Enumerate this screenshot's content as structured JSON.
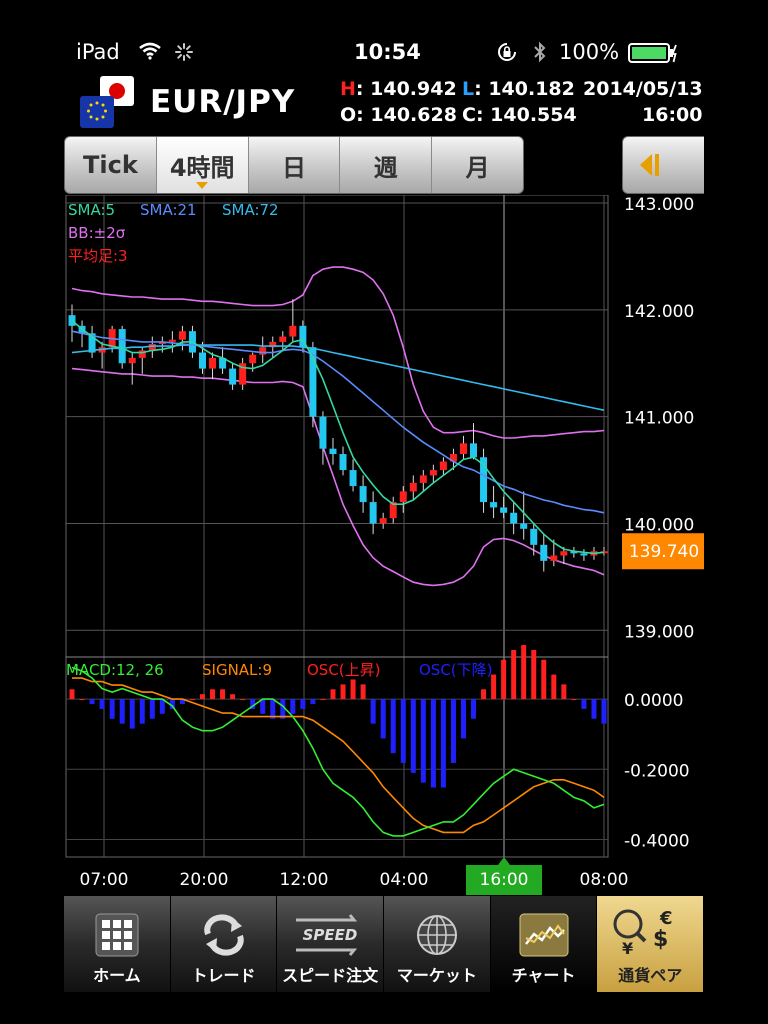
{
  "status": {
    "carrier": "iPad",
    "time": "10:54",
    "battery": "100%"
  },
  "header": {
    "pair": "EUR/JPY",
    "high_label": "H",
    "high": "140.942",
    "low_label": "L",
    "low": "140.182",
    "open_label": "O",
    "open": "140.628",
    "close_label": "C",
    "close": "140.554",
    "date": "2014/05/13",
    "time": "16:00"
  },
  "tabs": [
    "Tick",
    "4時間",
    "日",
    "週",
    "月"
  ],
  "selected_tab": 1,
  "chart_data": {
    "type": "line",
    "price_legend": [
      {
        "text": "SMA:5",
        "color": "#33d9a0"
      },
      {
        "text": "SMA:21",
        "color": "#5a8cff"
      },
      {
        "text": "SMA:72",
        "color": "#33bbee"
      }
    ],
    "bb_legend": {
      "text": "BB:±2σ",
      "color": "#e070f0"
    },
    "ha_legend": {
      "text": "平均足:3",
      "color": "#ff2020"
    },
    "price_ticks": [
      "143.000",
      "142.000",
      "141.000",
      "140.000",
      "139.000"
    ],
    "price_tick_values": [
      143,
      142,
      141,
      140,
      139
    ],
    "price_ylim": [
      138.75,
      143.0
    ],
    "current_price": "139.740",
    "current_price_value": 139.74,
    "macd_legend": [
      {
        "text": "MACD:12, 26",
        "color": "#33ee33"
      },
      {
        "text": "SIGNAL:9",
        "color": "#ff8800"
      },
      {
        "text": "OSC(上昇)",
        "color": "#ff2020"
      },
      {
        "text": "OSC(下降)",
        "color": "#2020ff"
      }
    ],
    "macd_ticks": [
      "0.0000",
      "-0.2000",
      "-0.4000"
    ],
    "macd_tick_values": [
      0,
      -0.2,
      -0.4
    ],
    "macd_ylim": [
      -0.45,
      0.12
    ],
    "time_labels": [
      "07:00",
      "20:00",
      "12:00",
      "04:00",
      "16:00",
      "08:00"
    ],
    "selected_time_label": 4,
    "candle_count": 54,
    "candles": [
      [
        141.95,
        142.05,
        141.7,
        141.85
      ],
      [
        141.85,
        141.9,
        141.65,
        141.78
      ],
      [
        141.78,
        141.85,
        141.55,
        141.6
      ],
      [
        141.6,
        141.7,
        141.45,
        141.65
      ],
      [
        141.65,
        141.85,
        141.6,
        141.82
      ],
      [
        141.82,
        141.85,
        141.45,
        141.5
      ],
      [
        141.5,
        141.6,
        141.3,
        141.55
      ],
      [
        141.55,
        141.65,
        141.4,
        141.62
      ],
      [
        141.62,
        141.75,
        141.55,
        141.68
      ],
      [
        141.68,
        141.75,
        141.6,
        141.7
      ],
      [
        141.7,
        141.8,
        141.6,
        141.72
      ],
      [
        141.72,
        141.85,
        141.62,
        141.8
      ],
      [
        141.8,
        141.85,
        141.55,
        141.6
      ],
      [
        141.6,
        141.7,
        141.4,
        141.45
      ],
      [
        141.45,
        141.6,
        141.35,
        141.55
      ],
      [
        141.55,
        141.65,
        141.4,
        141.45
      ],
      [
        141.45,
        141.5,
        141.25,
        141.3
      ],
      [
        141.3,
        141.55,
        141.25,
        141.5
      ],
      [
        141.5,
        141.6,
        141.42,
        141.58
      ],
      [
        141.58,
        141.75,
        141.5,
        141.65
      ],
      [
        141.65,
        141.75,
        141.55,
        141.7
      ],
      [
        141.7,
        141.8,
        141.62,
        141.75
      ],
      [
        141.75,
        142.1,
        141.7,
        141.85
      ],
      [
        141.85,
        141.9,
        141.6,
        141.65
      ],
      [
        141.65,
        141.7,
        140.9,
        141.0
      ],
      [
        141.0,
        141.05,
        140.55,
        140.7
      ],
      [
        140.7,
        140.8,
        140.55,
        140.65
      ],
      [
        140.65,
        140.72,
        140.45,
        140.5
      ],
      [
        140.5,
        140.6,
        140.3,
        140.35
      ],
      [
        140.35,
        140.45,
        140.1,
        140.2
      ],
      [
        140.2,
        140.3,
        139.9,
        140.0
      ],
      [
        140.0,
        140.1,
        139.95,
        140.05
      ],
      [
        140.05,
        140.25,
        140.0,
        140.2
      ],
      [
        140.2,
        140.35,
        140.1,
        140.3
      ],
      [
        140.3,
        140.45,
        140.22,
        140.38
      ],
      [
        140.38,
        140.5,
        140.3,
        140.45
      ],
      [
        140.45,
        140.55,
        140.38,
        140.5
      ],
      [
        140.5,
        140.62,
        140.45,
        140.58
      ],
      [
        140.58,
        140.7,
        140.5,
        140.65
      ],
      [
        140.65,
        140.82,
        140.6,
        140.75
      ],
      [
        140.75,
        140.94,
        140.6,
        140.62
      ],
      [
        140.62,
        140.7,
        140.1,
        140.2
      ],
      [
        140.2,
        140.35,
        140.05,
        140.15
      ],
      [
        140.15,
        140.25,
        140.05,
        140.1
      ],
      [
        140.1,
        140.2,
        139.9,
        140.0
      ],
      [
        140.0,
        140.3,
        139.85,
        139.95
      ],
      [
        139.95,
        140.0,
        139.7,
        139.8
      ],
      [
        139.8,
        139.9,
        139.55,
        139.65
      ],
      [
        139.65,
        139.85,
        139.6,
        139.7
      ],
      [
        139.7,
        139.78,
        139.62,
        139.74
      ],
      [
        139.74,
        139.78,
        139.68,
        139.72
      ],
      [
        139.72,
        139.76,
        139.65,
        139.7
      ],
      [
        139.7,
        139.78,
        139.66,
        139.74
      ],
      [
        139.74,
        139.78,
        139.7,
        139.74
      ]
    ],
    "sma5": [
      141.9,
      141.82,
      141.75,
      141.68,
      141.66,
      141.64,
      141.6,
      141.6,
      141.62,
      141.63,
      141.65,
      141.7,
      141.7,
      141.64,
      141.58,
      141.55,
      141.5,
      141.46,
      141.45,
      141.48,
      141.55,
      141.62,
      141.7,
      141.72,
      141.55,
      141.35,
      141.1,
      140.85,
      140.62,
      140.48,
      140.36,
      140.25,
      140.18,
      140.18,
      140.22,
      140.3,
      140.38,
      140.45,
      140.52,
      140.6,
      140.62,
      140.55,
      140.42,
      140.3,
      140.2,
      140.1,
      140.0,
      139.9,
      139.82,
      139.76,
      139.74,
      139.73,
      139.72,
      139.73
    ],
    "sma21": [
      141.8,
      141.78,
      141.76,
      141.74,
      141.73,
      141.72,
      141.71,
      141.7,
      141.7,
      141.7,
      141.69,
      141.68,
      141.67,
      141.66,
      141.65,
      141.64,
      141.63,
      141.62,
      141.61,
      141.6,
      141.6,
      141.62,
      141.63,
      141.62,
      141.58,
      141.52,
      141.45,
      141.38,
      141.3,
      141.22,
      141.14,
      141.06,
      140.98,
      140.9,
      140.83,
      140.76,
      140.7,
      140.64,
      140.58,
      140.53,
      140.5,
      140.45,
      140.4,
      140.35,
      140.32,
      140.28,
      140.25,
      140.22,
      140.2,
      140.17,
      140.15,
      140.13,
      140.12,
      140.1
    ],
    "sma72": [
      141.6,
      141.61,
      141.62,
      141.63,
      141.64,
      141.64,
      141.65,
      141.65,
      141.66,
      141.66,
      141.66,
      141.67,
      141.67,
      141.67,
      141.67,
      141.67,
      141.67,
      141.67,
      141.67,
      141.66,
      141.66,
      141.66,
      141.66,
      141.65,
      141.64,
      141.62,
      141.6,
      141.58,
      141.56,
      141.54,
      141.52,
      141.5,
      141.48,
      141.46,
      141.44,
      141.42,
      141.4,
      141.38,
      141.36,
      141.34,
      141.32,
      141.3,
      141.28,
      141.26,
      141.24,
      141.22,
      141.2,
      141.18,
      141.16,
      141.14,
      141.12,
      141.1,
      141.08,
      141.06
    ],
    "bb_upper": [
      142.2,
      142.18,
      142.17,
      142.15,
      142.14,
      142.13,
      142.12,
      142.12,
      142.11,
      142.1,
      142.1,
      142.1,
      142.09,
      142.08,
      142.08,
      142.07,
      142.06,
      142.05,
      142.04,
      142.04,
      142.04,
      142.05,
      142.08,
      142.14,
      142.32,
      142.38,
      142.4,
      142.4,
      142.38,
      142.35,
      142.28,
      142.15,
      141.95,
      141.65,
      141.3,
      141.05,
      140.9,
      140.85,
      140.85,
      140.86,
      140.87,
      140.85,
      140.82,
      140.8,
      140.8,
      140.81,
      140.82,
      140.82,
      140.83,
      140.84,
      140.85,
      140.86,
      140.86,
      140.87
    ],
    "bb_lower": [
      141.45,
      141.44,
      141.43,
      141.42,
      141.41,
      141.4,
      141.4,
      141.39,
      141.38,
      141.38,
      141.38,
      141.37,
      141.37,
      141.36,
      141.36,
      141.35,
      141.34,
      141.33,
      141.32,
      141.32,
      141.32,
      141.33,
      141.32,
      141.28,
      141.0,
      140.72,
      140.45,
      140.18,
      139.98,
      139.8,
      139.68,
      139.6,
      139.55,
      139.5,
      139.45,
      139.43,
      139.42,
      139.43,
      139.45,
      139.5,
      139.6,
      139.78,
      139.85,
      139.86,
      139.84,
      139.8,
      139.75,
      139.7,
      139.66,
      139.63,
      139.6,
      139.58,
      139.56,
      139.52
    ],
    "macd": [
      0.09,
      0.08,
      0.06,
      0.03,
      0.02,
      0.03,
      0.02,
      0.01,
      0.0,
      0.0,
      -0.02,
      -0.06,
      -0.08,
      -0.09,
      -0.09,
      -0.08,
      -0.06,
      -0.04,
      -0.02,
      -0.0,
      0.0,
      -0.02,
      -0.05,
      -0.09,
      -0.14,
      -0.2,
      -0.24,
      -0.26,
      -0.28,
      -0.31,
      -0.35,
      -0.38,
      -0.39,
      -0.39,
      -0.38,
      -0.37,
      -0.36,
      -0.35,
      -0.35,
      -0.33,
      -0.3,
      -0.27,
      -0.24,
      -0.22,
      -0.2,
      -0.21,
      -0.22,
      -0.23,
      -0.24,
      -0.26,
      -0.28,
      -0.29,
      -0.31,
      -0.3
    ],
    "signal": [
      0.06,
      0.06,
      0.05,
      0.05,
      0.04,
      0.04,
      0.03,
      0.02,
      0.02,
      0.01,
      0.0,
      0.0,
      -0.01,
      -0.02,
      -0.03,
      -0.04,
      -0.04,
      -0.05,
      -0.05,
      -0.05,
      -0.05,
      -0.05,
      -0.05,
      -0.05,
      -0.06,
      -0.08,
      -0.1,
      -0.12,
      -0.15,
      -0.18,
      -0.21,
      -0.25,
      -0.28,
      -0.31,
      -0.34,
      -0.36,
      -0.37,
      -0.38,
      -0.38,
      -0.38,
      -0.36,
      -0.35,
      -0.33,
      -0.31,
      -0.29,
      -0.27,
      -0.25,
      -0.24,
      -0.23,
      -0.23,
      -0.24,
      -0.25,
      -0.26,
      -0.28
    ],
    "osc": [
      0.02,
      0.0,
      -0.01,
      -0.02,
      -0.04,
      -0.05,
      -0.06,
      -0.05,
      -0.04,
      -0.03,
      -0.02,
      -0.01,
      -0.0,
      0.01,
      0.02,
      0.02,
      0.01,
      -0.0,
      -0.02,
      -0.03,
      -0.04,
      -0.04,
      -0.03,
      -0.02,
      -0.01,
      0.0,
      0.02,
      0.03,
      0.04,
      0.03,
      -0.05,
      -0.08,
      -0.11,
      -0.13,
      -0.15,
      -0.17,
      -0.18,
      -0.18,
      -0.13,
      -0.08,
      -0.04,
      0.02,
      0.05,
      0.08,
      0.1,
      0.11,
      0.1,
      0.08,
      0.05,
      0.03,
      0.0,
      -0.02,
      -0.04,
      -0.05
    ]
  },
  "tabbar": [
    {
      "label": "ホーム",
      "icon": "home-grid-icon"
    },
    {
      "label": "トレード",
      "icon": "trade-arrows-icon"
    },
    {
      "label": "スピード注文",
      "icon": "speed-order-icon",
      "icon_text": "SPEED"
    },
    {
      "label": "マーケット",
      "icon": "globe-icon"
    },
    {
      "label": "チャート",
      "icon": "chart-icon"
    },
    {
      "label": "通貨ペア",
      "icon": "currency-pair-icon",
      "icon_text_1": "€",
      "icon_text_2": "$",
      "icon_text_3": "¥"
    }
  ],
  "selected_tabbar": 4,
  "colors": {
    "bull": "#ff2020",
    "bear": "#22c8f0",
    "grid": "#555555",
    "price_badge": "#ff8800",
    "time_highlight": "#22aa22"
  }
}
